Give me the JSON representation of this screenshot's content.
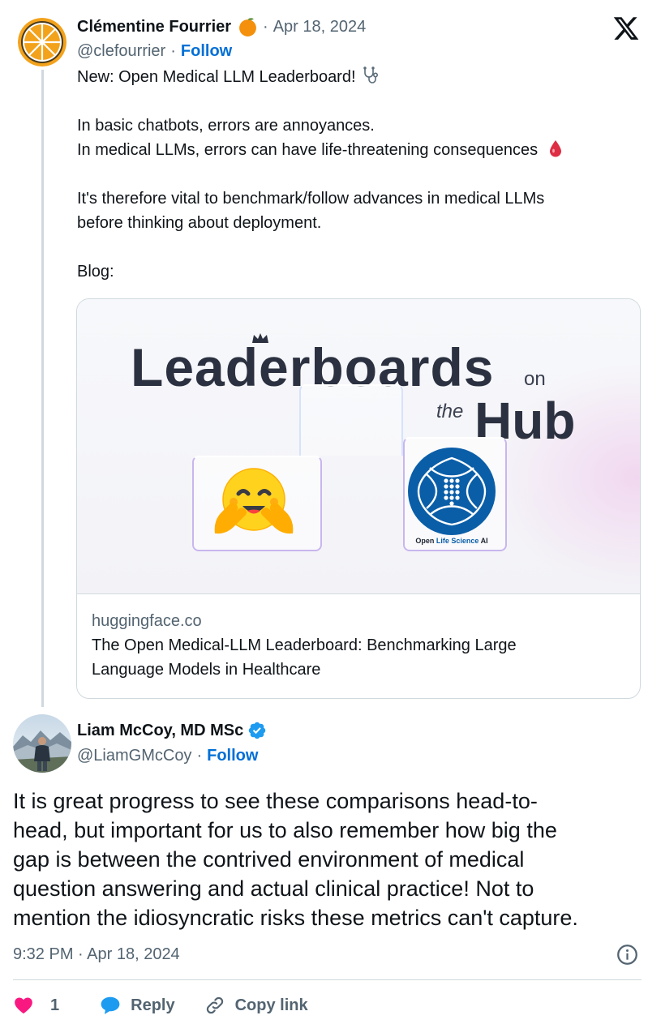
{
  "parent_tweet": {
    "author_name": "Clémentine Fourrier",
    "date": "Apr 18, 2024",
    "handle": "@clefourrier",
    "follow_label": "Follow",
    "text_lines": [
      "New: Open Medical LLM Leaderboard!",
      "",
      "In basic chatbots, errors are annoyances.",
      "In medical LLMs, errors can have life-threatening consequences",
      "",
      "It's therefore vital to benchmark/follow advances in medical LLMs",
      "before thinking about deployment.",
      "",
      "Blog:"
    ],
    "card": {
      "image_title_main": "Leaderboards",
      "image_title_on": "on",
      "image_title_the": "the",
      "image_title_hub": "Hub",
      "partner_logo_text_1": "Open ",
      "partner_logo_text_2": "Life Science",
      "partner_logo_text_3": " AI",
      "domain": "huggingface.co",
      "title_lines": [
        "The Open Medical-LLM Leaderboard: Benchmarking Large",
        "Language Models in Healthcare"
      ]
    }
  },
  "main_tweet": {
    "author_name": "Liam McCoy, MD MSc",
    "handle": "@LiamGMcCoy",
    "follow_label": "Follow",
    "text_lines": [
      "It is great progress to see these comparisons head-to-",
      "head, but important for us to also remember how big the",
      "gap is between the contrived environment of medical",
      "question answering and actual clinical practice! Not to",
      "mention the idiosyncratic risks these metrics can't capture."
    ],
    "timestamp": "9:32 PM · Apr 18, 2024",
    "actions": {
      "like_count": "1",
      "reply_label": "Reply",
      "copy_link_label": "Copy link"
    }
  },
  "icons": {
    "brand": "x-logo",
    "like": "heart-icon",
    "reply": "speech-bubble-icon",
    "copy": "link-icon",
    "info": "info-icon",
    "verified": "verified-badge-icon"
  },
  "colors": {
    "text": "#0f1419",
    "secondary": "#536471",
    "link": "#006fd6",
    "like": "#f91880",
    "reply": "#1d9bf0",
    "border": "#cfd9de",
    "verified": "#1d9bf0"
  }
}
